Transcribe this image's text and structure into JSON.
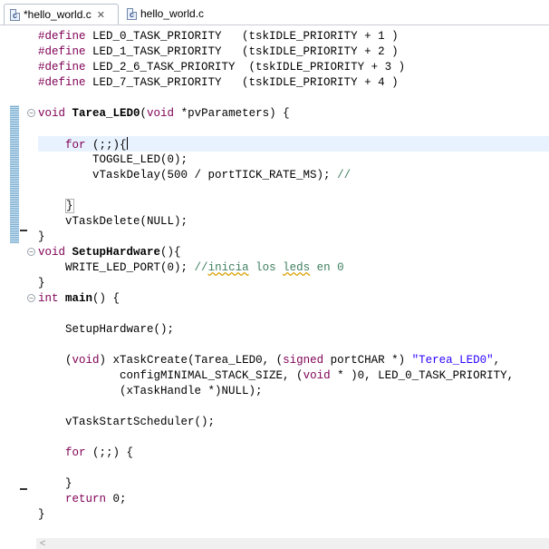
{
  "tabs": [
    {
      "label": "*hello_world.c",
      "icon": "c-file-icon",
      "close": "✕"
    },
    {
      "label": "hello_world.c",
      "icon": "c-file-icon"
    }
  ],
  "code": {
    "l1a": "#define",
    "l1b": " LED_0_TASK_PRIORITY   (tskIDLE_PRIORITY + 1 )",
    "l2a": "#define",
    "l2b": " LED_1_TASK_PRIORITY   (tskIDLE_PRIORITY + 2 )",
    "l3a": "#define",
    "l3b": " LED_2_6_TASK_PRIORITY  (tskIDLE_PRIORITY + 3 )",
    "l4a": "#define",
    "l4b": " LED_7_TASK_PRIORITY   (tskIDLE_PRIORITY + 4 )",
    "l5kw": "void",
    "l5fn": " Tarea_LED0",
    "l5a": "(",
    "l5kw2": "void",
    "l5b": " *pvParameters) {",
    "l6kw": "for",
    "l6b": " (;;){",
    "l7": "TOGGLE_LED(0);",
    "l8a": "vTaskDelay(500 / portTICK_RATE_MS); ",
    "l8cm": "//",
    "l9": "}",
    "l10": "vTaskDelete(NULL);",
    "l11": "}",
    "l12kw": "void",
    "l12fn": " SetupHardware",
    "l12b": "(){",
    "l13a": "WRITE_LED_PORT(0); ",
    "l13cm1": "//",
    "l13sq1": "inicia",
    "l13cm2": " los ",
    "l13sq2": "leds",
    "l13cm3": " en 0",
    "l14": "}",
    "l15kw": "int",
    "l15fn": " main",
    "l15b": "() {",
    "l16": "SetupHardware();",
    "l17a": "(",
    "l17kw": "void",
    "l17b": ") xTaskCreate(Tarea_LED0, (",
    "l17kw2": "signed",
    "l17c": " portCHAR *) ",
    "l17str": "\"Terea_LED0\"",
    "l17d": ",",
    "l18a": "configMINIMAL_STACK_SIZE, (",
    "l18kw": "void",
    "l18b": " * )0, LED_0_TASK_PRIORITY,",
    "l19": "(xTaskHandle *)NULL);",
    "l20": "vTaskStartScheduler();",
    "l21kw": "for",
    "l21b": " (;;) {",
    "l22": "}",
    "l23kw": "return",
    "l23b": " 0;",
    "l24": "}"
  },
  "scroll_arrow": "<"
}
